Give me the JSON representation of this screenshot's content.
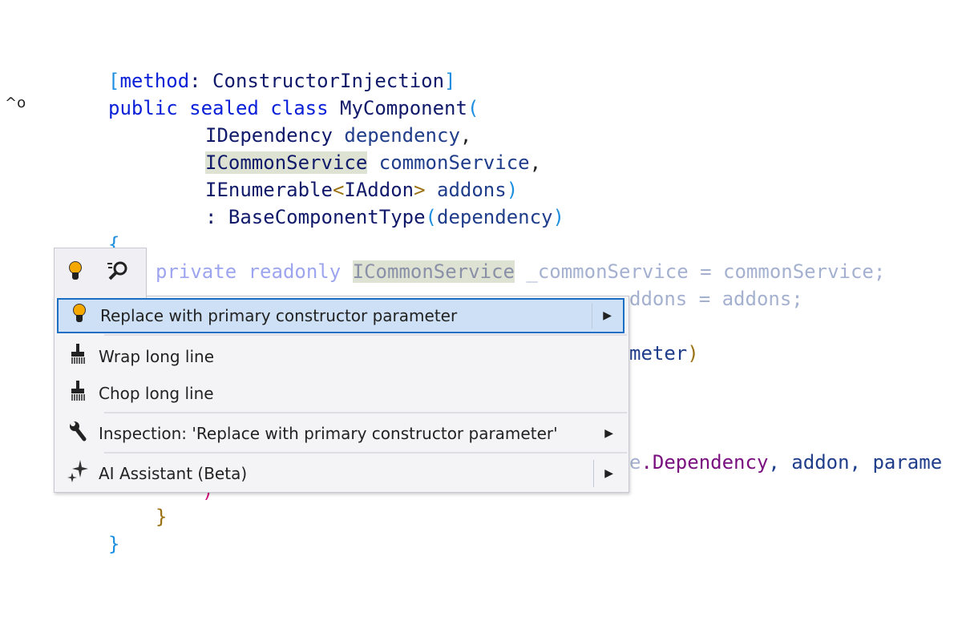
{
  "gutter": {
    "icon": "implementation-up-icon",
    "glyph": "^o"
  },
  "code": {
    "l1": [
      "[",
      "method",
      ": ConstructorInjection",
      "]"
    ],
    "l2": [
      "public sealed class",
      " MyComponent",
      "("
    ],
    "l3": [
      "IDependency",
      " dependency",
      ","
    ],
    "l4": [
      "ICommonService",
      " commonService",
      ","
    ],
    "l5": [
      "IEnumerable",
      "<",
      "IAddon",
      ">",
      " addons",
      ")"
    ],
    "l6": [
      ": BaseComponentType",
      "(",
      "dependency",
      ")"
    ],
    "l7": "{",
    "l8": [
      "private readonly ",
      "ICommonService",
      " _commonService = commonService;"
    ],
    "l9": "ddons = addons;",
    "l11": [
      "meter",
      ")"
    ],
    "l13": [
      "e",
      ".Dependency",
      ", addon, parame"
    ],
    "l14": ")",
    "l15": "}",
    "l16": "}"
  },
  "tabs": [
    {
      "icon": "lightbulb-icon"
    },
    {
      "icon": "find-usages-icon"
    }
  ],
  "menu": {
    "items": [
      {
        "label": "Replace with primary constructor parameter",
        "icon": "lightbulb-icon",
        "selected": true,
        "submenu": true
      },
      {
        "label": "Wrap long line",
        "icon": "broom-icon",
        "submenu": false
      },
      {
        "label": "Chop long line",
        "icon": "broom-icon",
        "submenu": false
      },
      {
        "label": "Inspection: 'Replace with primary constructor parameter'",
        "icon": "wrench-icon",
        "submenu": true
      },
      {
        "label": "AI Assistant (Beta)",
        "icon": "sparkle-icon",
        "submenu": true
      }
    ],
    "arrow": "▶"
  },
  "colors": {
    "keyword": "#0a1fd8",
    "selection": "#cde0f5",
    "selection_border": "#1a6fc4",
    "highlight": "#dde2d2",
    "bulb": "#f5a800"
  }
}
